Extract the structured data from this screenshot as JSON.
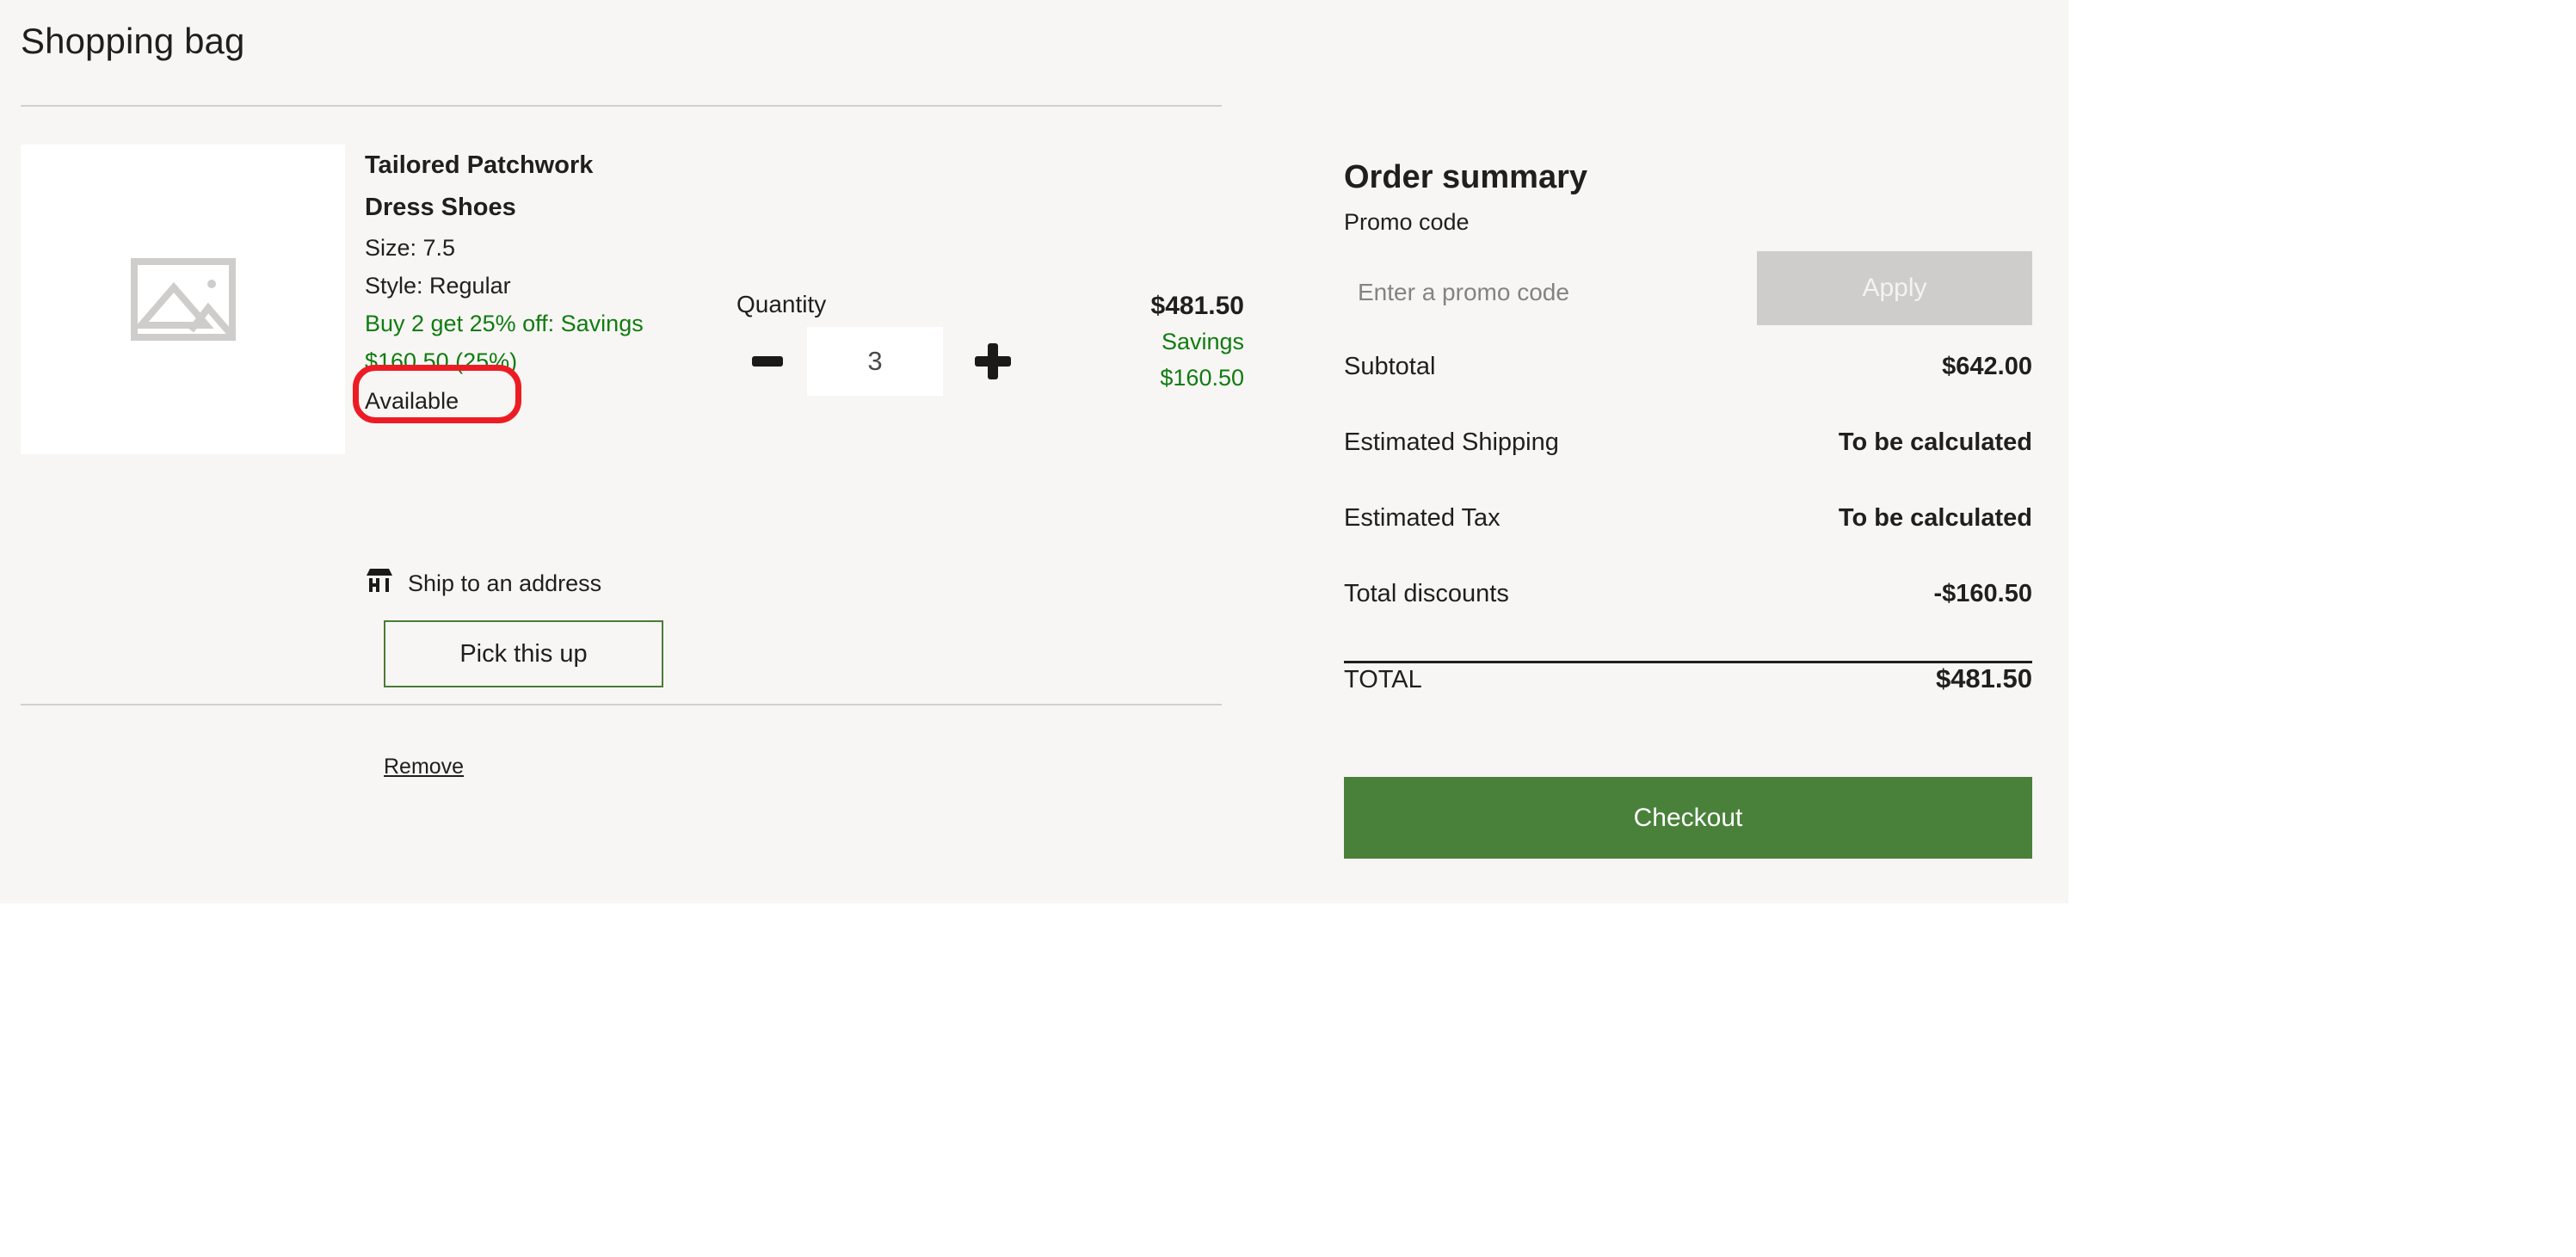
{
  "page": {
    "title": "Shopping bag"
  },
  "colors": {
    "panel_background": "#f7f6f4",
    "savings_green": "#107c10",
    "checkout_green": "#49813a",
    "pickup_border_green": "#4a7c36",
    "apply_disabled": "#cfcdcb",
    "annotation_red": "#ed1c24"
  },
  "line_item": {
    "thumbnail_icon": "image-placeholder-icon",
    "product_name": "Tailored Patchwork Dress Shoes",
    "size": "Size: 7.5",
    "style": "Style: Regular",
    "promotion": "Buy 2 get 25% off: Savings $160.50 (25%)",
    "availability": "Available",
    "fulfillment_icon": "store-icon",
    "fulfillment_label": "Ship to an address",
    "pickup_button": "Pick this up",
    "remove_link": "Remove",
    "quantity_label": "Quantity",
    "quantity_value": "3",
    "decrease_icon": "minus-icon",
    "increase_icon": "plus-icon",
    "price": "$481.50",
    "savings_label": "Savings",
    "savings_amount": "$160.50"
  },
  "order_summary": {
    "title": "Order summary",
    "promo_label": "Promo code",
    "promo_placeholder": "Enter a promo code",
    "promo_value": "",
    "apply_label": "Apply",
    "rows": [
      {
        "label": "Subtotal",
        "value": "$642.00"
      },
      {
        "label": "Estimated Shipping",
        "value": "To be calculated"
      },
      {
        "label": "Estimated Tax",
        "value": "To be calculated"
      },
      {
        "label": "Total discounts",
        "value": "-$160.50"
      }
    ],
    "total_label": "TOTAL",
    "total_value": "$481.50",
    "checkout_label": "Checkout"
  }
}
